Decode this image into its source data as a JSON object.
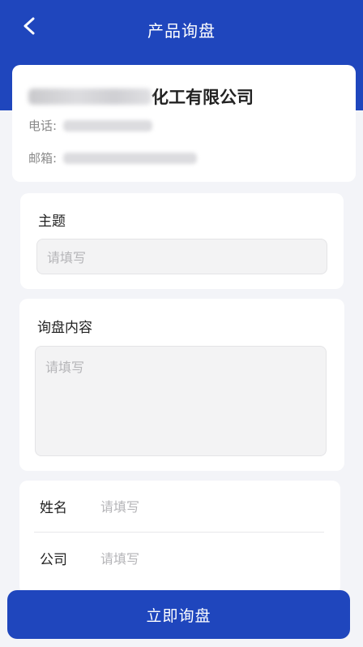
{
  "nav": {
    "title": "产品询盘"
  },
  "company": {
    "name_visible": "化工有限公司",
    "phone_label": "电话:",
    "email_label": "邮箱:"
  },
  "form": {
    "subject": {
      "label": "主题",
      "placeholder": "请填写"
    },
    "content": {
      "label": "询盘内容",
      "placeholder": "请填写"
    },
    "name": {
      "label": "姓名",
      "placeholder": "请填写"
    },
    "company": {
      "label": "公司",
      "placeholder": "请填写"
    }
  },
  "submit": {
    "label": "立即询盘"
  },
  "colors": {
    "primary": "#1f46bd",
    "background": "#f3f4f8",
    "placeholder": "#b5b5b8"
  },
  "icons": {
    "back": "chevron-left-icon"
  }
}
